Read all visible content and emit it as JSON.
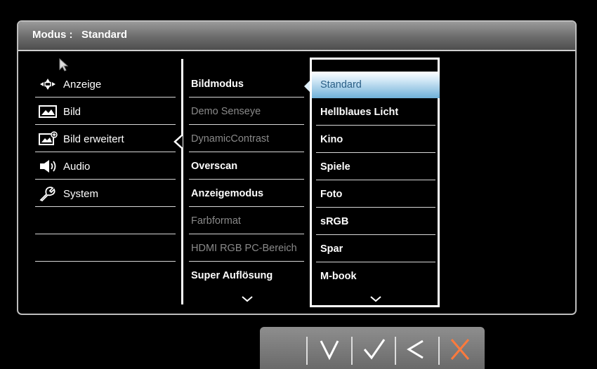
{
  "header": {
    "label": "Modus :",
    "value": "Standard"
  },
  "main_menu": [
    {
      "label": "Anzeige",
      "icon": "display-adjust-icon"
    },
    {
      "label": "Bild",
      "icon": "picture-icon"
    },
    {
      "label": "Bild erweitert",
      "icon": "picture-advanced-icon"
    },
    {
      "label": "Audio",
      "icon": "speaker-icon"
    },
    {
      "label": "System",
      "icon": "wrench-icon"
    }
  ],
  "sub_menu": [
    {
      "label": "Bildmodus",
      "enabled": true
    },
    {
      "label": "Demo Senseye",
      "enabled": false
    },
    {
      "label": "DynamicContrast",
      "enabled": false
    },
    {
      "label": "Overscan",
      "enabled": true
    },
    {
      "label": "Anzeigemodus",
      "enabled": true
    },
    {
      "label": "Farbformat",
      "enabled": false
    },
    {
      "label": "HDMI RGB PC-Bereich",
      "enabled": false
    },
    {
      "label": "Super Auflösung",
      "enabled": true
    }
  ],
  "options": [
    {
      "label": "Standard",
      "selected": true
    },
    {
      "label": "Hellblaues Licht"
    },
    {
      "label": "Kino"
    },
    {
      "label": "Spiele"
    },
    {
      "label": "Foto"
    },
    {
      "label": "sRGB"
    },
    {
      "label": "Spar"
    },
    {
      "label": "M-book"
    }
  ],
  "bottom_keys": [
    "chevron-down-icon",
    "check-icon",
    "back-icon",
    "close-icon"
  ],
  "colors": {
    "accent_close": "#ff7a3c",
    "highlight": "#6fb0d8",
    "disabled_text": "#8a8a8a"
  }
}
